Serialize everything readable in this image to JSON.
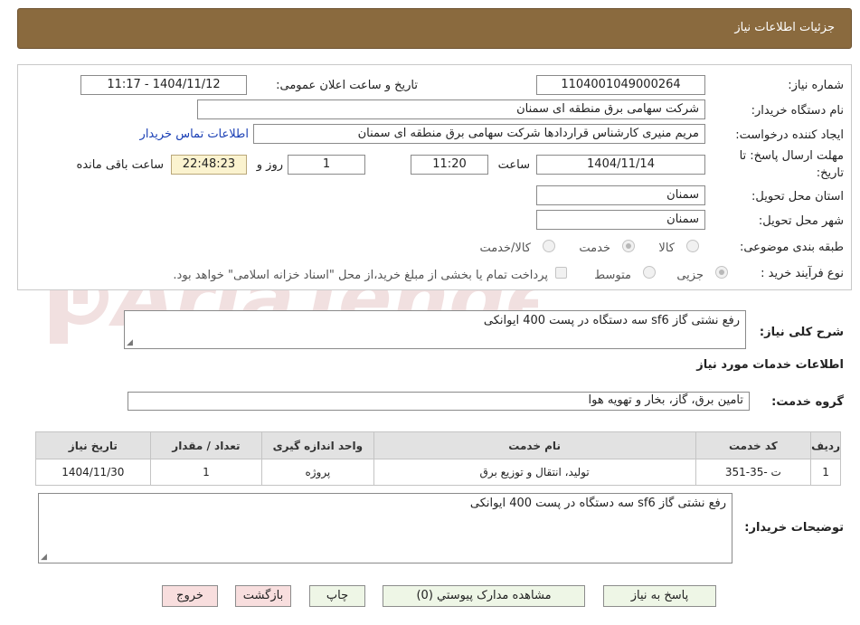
{
  "header": {
    "title": "جزئیات اطلاعات نیاز"
  },
  "form": {
    "need_number_label": "شماره نیاز:",
    "need_number": "1104001049000264",
    "announce_label": "تاریخ و ساعت اعلان عمومی:",
    "announce_value": "1404/11/12 - 11:17",
    "buyer_org_label": "نام دستگاه خریدار:",
    "buyer_org": "شرکت سهامی برق منطقه ای سمنان",
    "creator_label": "ایجاد کننده درخواست:",
    "creator": "مریم منیری کارشناس قراردادها شرکت سهامی برق منطقه ای سمنان",
    "contact_link": "اطلاعات تماس خریدار",
    "deadline_label_1": "مهلت ارسال پاسخ: تا",
    "deadline_label_2": "تاریخ:",
    "deadline_date": "1404/11/14",
    "time_label": "ساعت",
    "deadline_time": "11:20",
    "days_value": "1",
    "days_label": "روز و",
    "remaining_time": "22:48:23",
    "remaining_label": "ساعت باقی مانده",
    "province_label": "استان محل تحویل:",
    "province": "سمنان",
    "city_label": "شهر محل تحویل:",
    "city": "سمنان",
    "category_label": "طبقه بندی موضوعی:",
    "category_options": [
      "کالا",
      "خدمت",
      "کالا/خدمت"
    ],
    "purchase_type_label": "نوع فرآیند خرید :",
    "purchase_options": [
      "جزیی",
      "متوسط"
    ],
    "payment_note": "پرداخت تمام یا بخشی از مبلغ خرید،از محل \"اسناد خزانه اسلامی\" خواهد بود."
  },
  "summary": {
    "label": "شرح کلی نیاز:",
    "text": "رفع نشتی گاز sf6  سه دستگاه در پست 400 ایوانکی"
  },
  "services": {
    "section_title": "اطلاعات خدمات مورد نیاز",
    "group_label": "گروه خدمت:",
    "group_value": "تامین برق، گاز، بخار و تهویه هوا",
    "columns": [
      "ردیف",
      "کد خدمت",
      "نام خدمت",
      "واحد اندازه گیری",
      "تعداد / مقدار",
      "تاریخ نیاز"
    ],
    "rows": [
      [
        "1",
        "ت -35-351",
        "تولید، انتقال و توزیع برق",
        "پروژه",
        "1",
        "1404/11/30"
      ]
    ]
  },
  "buyer_notes": {
    "label": "توضیحات خریدار:",
    "text": "رفع نشتی گاز sf6  سه دستگاه در پست 400 ایوانکی"
  },
  "buttons": {
    "reply": "پاسخ به نیاز",
    "attachments": "مشاهده مدارک پیوستي (0)",
    "print": "چاپ",
    "back": "بازگشت",
    "exit": "خروج"
  },
  "watermark": {
    "text": "AriaTender.neT"
  },
  "colors": {
    "header": "#8a6a3e",
    "timer_bg": "#fbf3cf",
    "link": "#1a3fb5",
    "button_green": "#eef6e6",
    "button_pink": "#f8dede"
  }
}
